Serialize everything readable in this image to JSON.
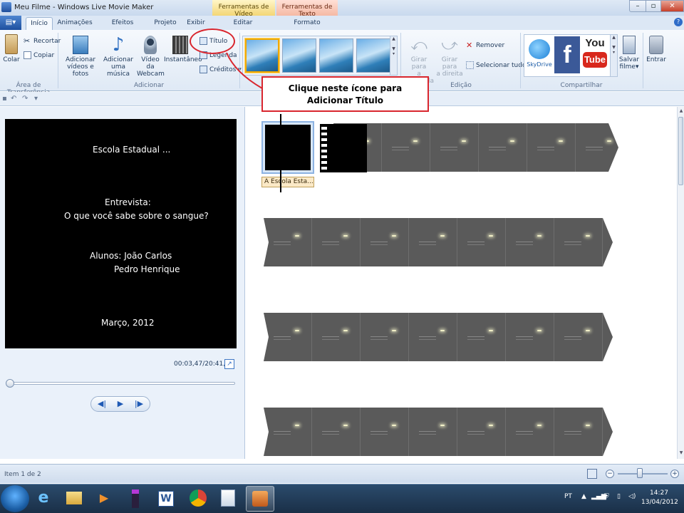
{
  "window": {
    "title": "Meu Filme - Windows Live Movie Maker",
    "context_video": "Ferramentas de Vídeo",
    "context_text": "Ferramentas de Texto"
  },
  "tabs": [
    {
      "label": "Início",
      "active": true
    },
    {
      "label": "Animações"
    },
    {
      "label": "Efeitos Visuais"
    },
    {
      "label": "Projeto"
    },
    {
      "label": "Exibir"
    },
    {
      "label": "Editar"
    },
    {
      "label": "Formato"
    }
  ],
  "ribbon": {
    "clipboard": {
      "paste": "Colar",
      "cut": "Recortar",
      "copy": "Copiar",
      "group": "Área de Transferência"
    },
    "add": {
      "videos_line1": "Adicionar",
      "videos_line2": "vídeos e fotos",
      "music_line1": "Adicionar",
      "music_line2": "uma música",
      "webcam_line1": "Vídeo da",
      "webcam_line2": "Webcam",
      "snapshot": "Instantâneo",
      "title": "Título",
      "caption": "Legenda",
      "credits": "Créditos",
      "group": "Adicionar"
    },
    "edit": {
      "rotate_left_line1": "Girar para",
      "rotate_left_line2": "a esquerda",
      "rotate_right_line1": "Girar para",
      "rotate_right_line2": "a direita",
      "remove": "Remover",
      "select_all": "Selecionar tudo",
      "group": "Edição"
    },
    "share": {
      "skydrive": "SkyDrive",
      "youtube_top": "You",
      "youtube_bottom": "Tube",
      "facebook": "f",
      "save_movie_line1": "Salvar",
      "save_movie_line2": "filme",
      "signin": "Entrar",
      "group": "Compartilhar"
    }
  },
  "preview": {
    "lines": [
      "Escola Estadual ...",
      "Entrevista:",
      "O que você sabe sobre o sangue?",
      "Alunos: João Carlos",
      "Pedro Henrique",
      "Março, 2012"
    ],
    "timecode": "00:03,47/20:41,33"
  },
  "storyboard": {
    "title_clip_caption": "A Escola Esta..."
  },
  "callout": {
    "line1": "Clique neste ícone para",
    "line2": "Adicionar Título"
  },
  "status": {
    "item": "Item 1 de 2"
  },
  "taskbar": {
    "lang": "PT",
    "time": "14:27",
    "date": "13/04/2012"
  },
  "colors": {
    "accent_red": "#d9262e",
    "ribbon_bg": "#dfe9f5"
  }
}
